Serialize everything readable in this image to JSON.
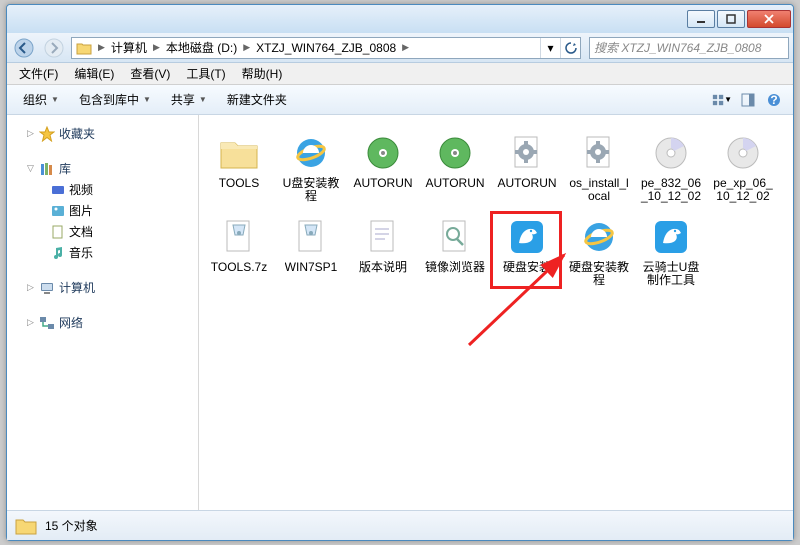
{
  "breadcrumb": {
    "items": [
      "计算机",
      "本地磁盘 (D:)",
      "XTZJ_WIN764_ZJB_0808"
    ]
  },
  "search": {
    "placeholder": "搜索 XTZJ_WIN764_ZJB_0808"
  },
  "menu": {
    "file": "文件(F)",
    "edit": "编辑(E)",
    "view": "查看(V)",
    "tools": "工具(T)",
    "help": "帮助(H)"
  },
  "toolbar": {
    "organize": "组织",
    "include": "包含到库中",
    "share": "共享",
    "newfolder": "新建文件夹"
  },
  "sidebar": {
    "favorites": "收藏夹",
    "library": "库",
    "libs": {
      "videos": "视频",
      "pictures": "图片",
      "documents": "文档",
      "music": "音乐"
    },
    "computer": "计算机",
    "network": "网络"
  },
  "files": [
    {
      "name": "TOOLS",
      "type": "folder"
    },
    {
      "name": "U盘安装教程",
      "type": "ie"
    },
    {
      "name": "AUTORUN",
      "type": "disc-green"
    },
    {
      "name": "AUTORUN",
      "type": "disc-green"
    },
    {
      "name": "AUTORUN",
      "type": "gear"
    },
    {
      "name": "os_install_local",
      "type": "gear"
    },
    {
      "name": "pe_832_06_10_12_02",
      "type": "disc"
    },
    {
      "name": "pe_xp_06_10_12_02",
      "type": "disc"
    },
    {
      "name": "TOOLS.7z",
      "type": "archive"
    },
    {
      "name": "WIN7SP1",
      "type": "archive"
    },
    {
      "name": "版本说明",
      "type": "text"
    },
    {
      "name": "镜像浏览器",
      "type": "magnify"
    },
    {
      "name": "硬盘安装",
      "type": "knight-blue",
      "highlight": true
    },
    {
      "name": "硬盘安装教程",
      "type": "ie"
    },
    {
      "name": "云骑士U盘制作工具",
      "type": "knight-blue"
    }
  ],
  "status": {
    "count": "15 个对象"
  }
}
